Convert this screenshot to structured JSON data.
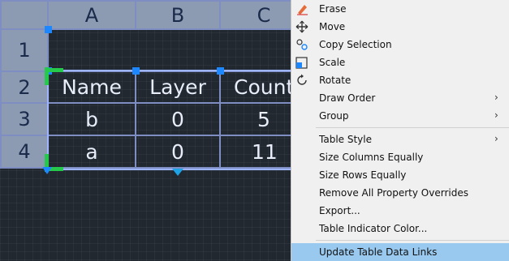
{
  "table": {
    "column_headers": [
      "A",
      "B",
      "C"
    ],
    "row_headers": [
      "1",
      "2",
      "3",
      "4"
    ],
    "rows": [
      [
        "Name",
        "Layer",
        "Count"
      ],
      [
        "b",
        "0",
        "5"
      ],
      [
        "a",
        "0",
        "11"
      ]
    ]
  },
  "context_menu": {
    "items": [
      {
        "label": "Erase",
        "icon": "eraser-icon"
      },
      {
        "label": "Move",
        "icon": "move-arrows-icon"
      },
      {
        "label": "Copy Selection",
        "icon": "copy-selection-icon"
      },
      {
        "label": "Scale",
        "icon": "scale-icon"
      },
      {
        "label": "Rotate",
        "icon": "rotate-icon"
      },
      {
        "label": "Draw Order",
        "submenu": true
      },
      {
        "label": "Group",
        "submenu": true
      },
      {
        "label": "Table Style",
        "submenu": true
      },
      {
        "label": "Size Columns Equally"
      },
      {
        "label": "Size Rows Equally"
      },
      {
        "label": "Remove All Property Overrides"
      },
      {
        "label": "Export..."
      },
      {
        "label": "Table Indicator Color..."
      },
      {
        "label": "Update Table Data Links",
        "highlighted": true
      }
    ]
  },
  "colors": {
    "highlight": "#99c9ef",
    "grip_blue": "#1d87ff",
    "grip_green": "#25c94c",
    "header_fill": "#8c9ab2"
  }
}
